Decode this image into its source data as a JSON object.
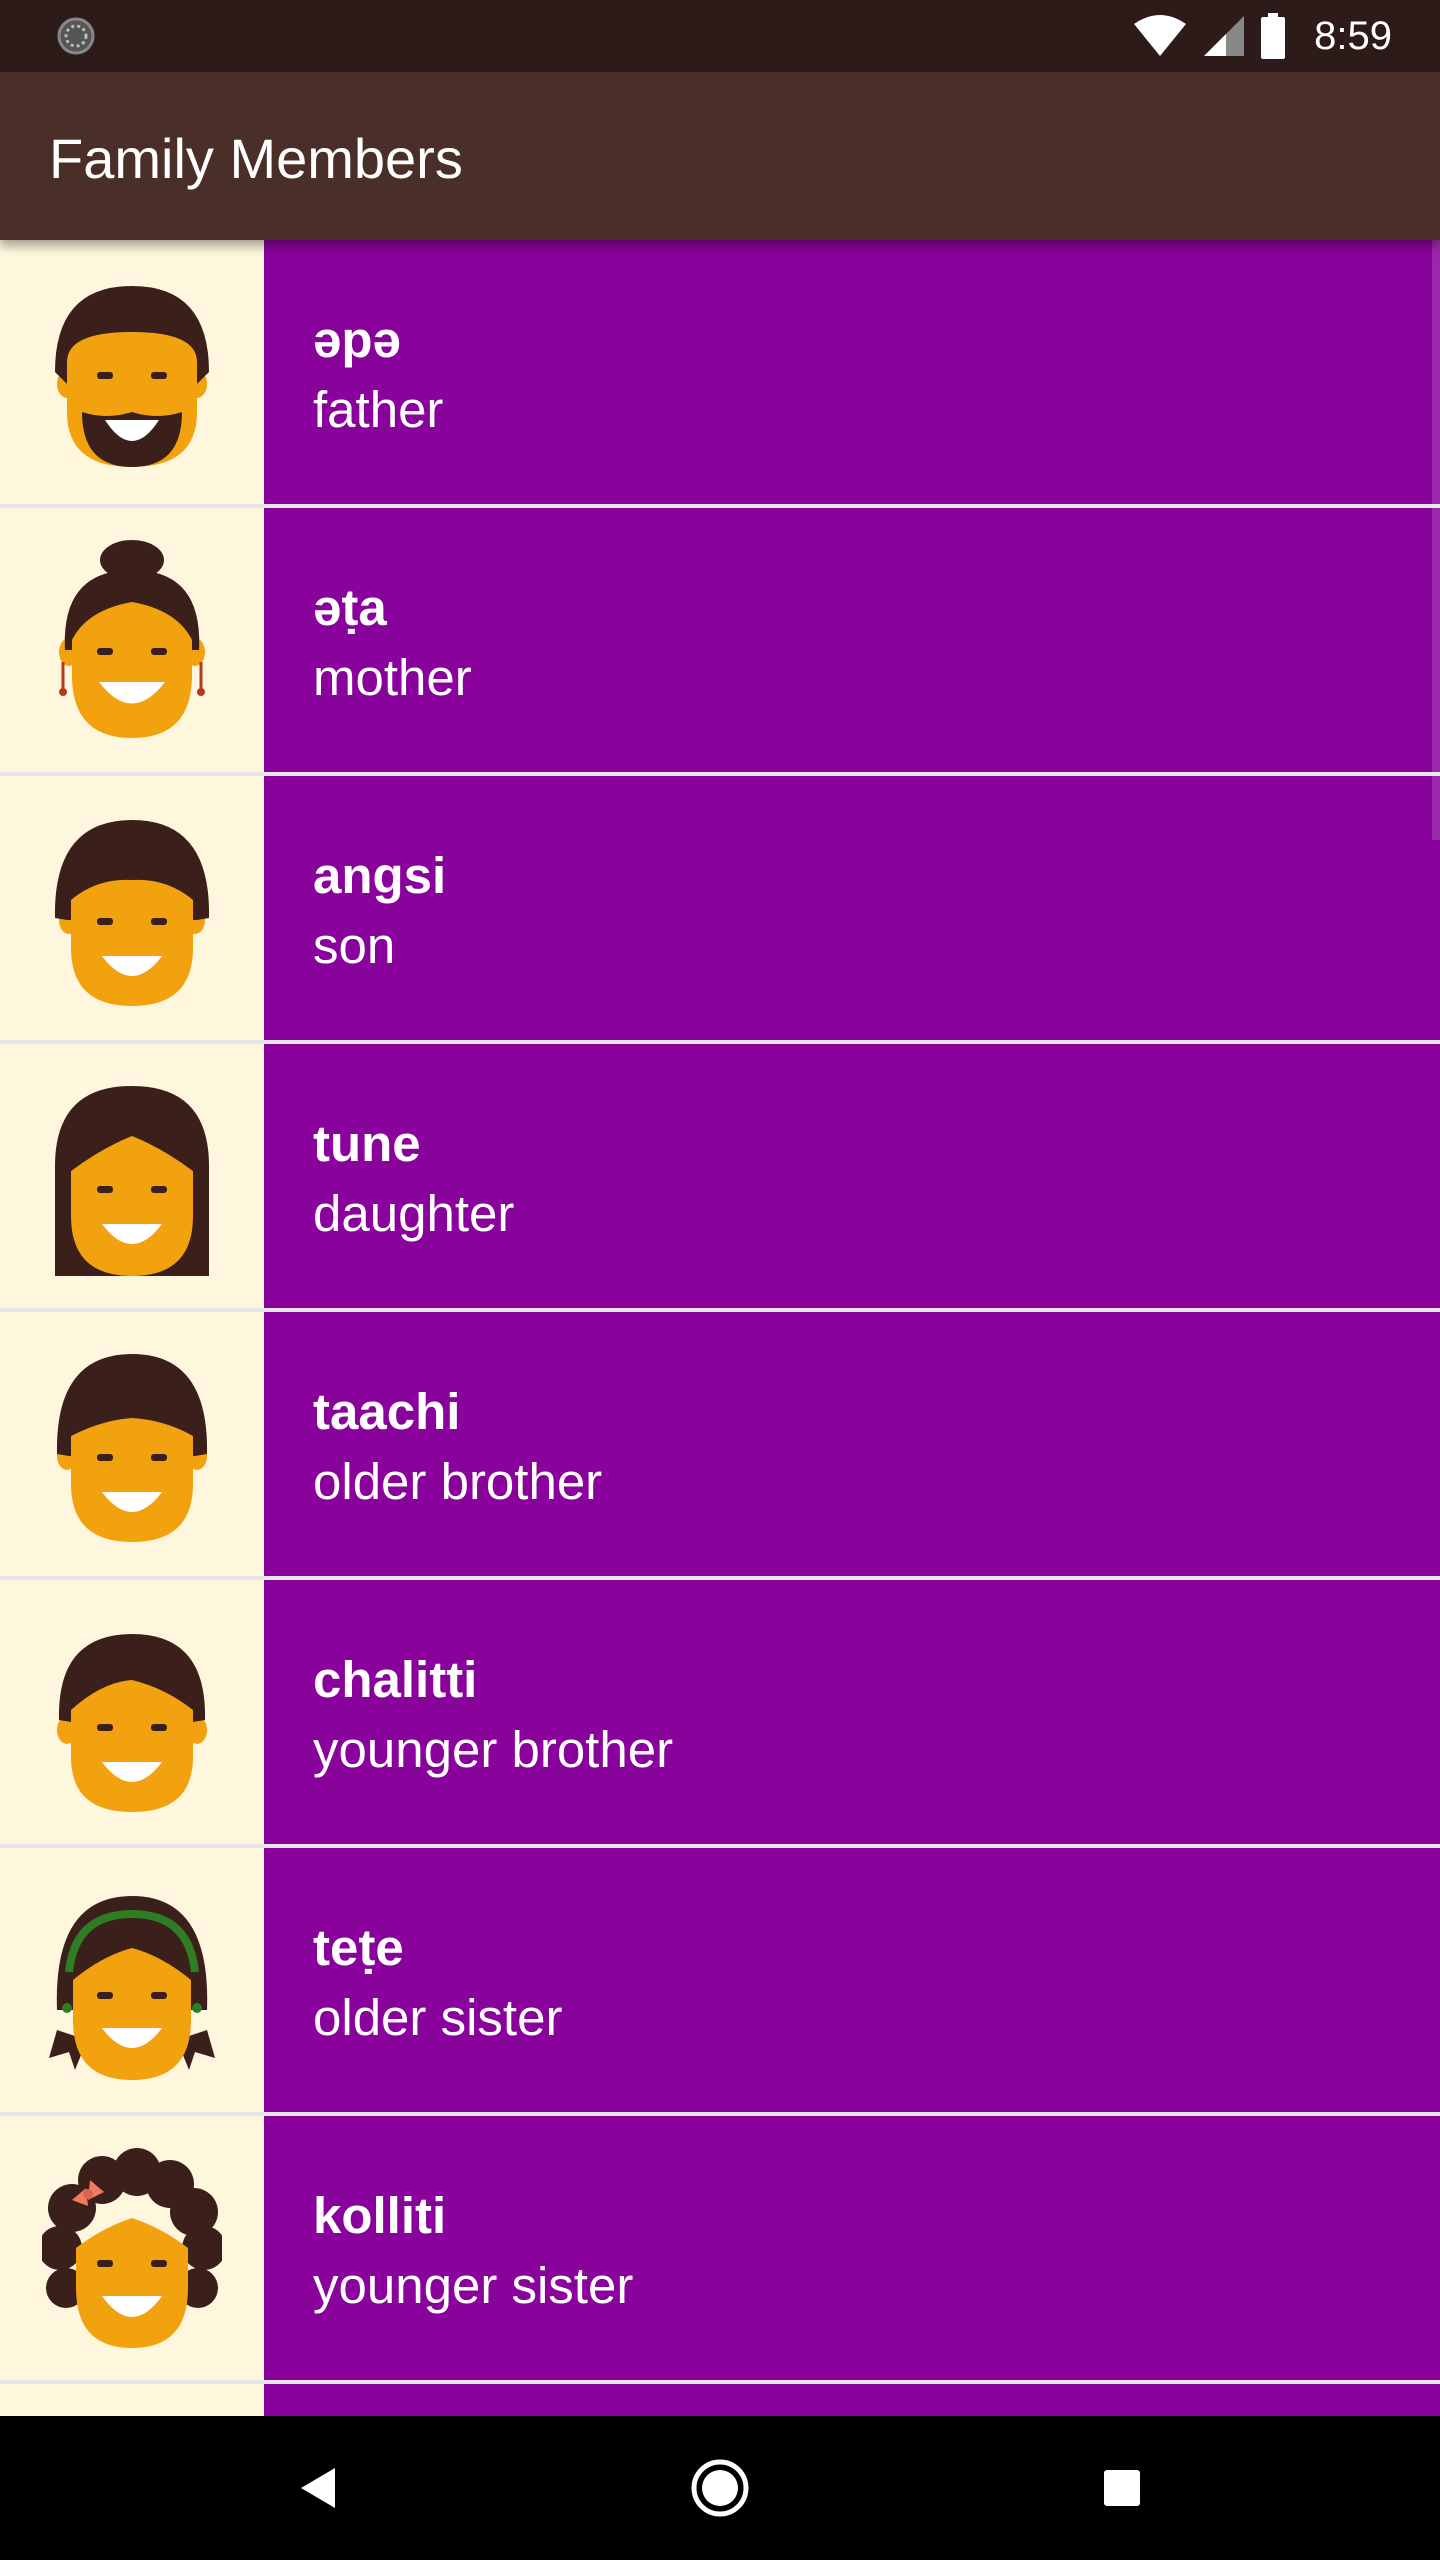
{
  "status_bar": {
    "time": "8:59",
    "icons": [
      "loading-icon",
      "wifi-icon",
      "cell-signal-icon",
      "battery-icon"
    ]
  },
  "app_bar": {
    "title": "Family Members"
  },
  "colors": {
    "status_bar": "#2d1b19",
    "app_bar": "#4a2f28",
    "item_background": "#8a029c",
    "image_background": "#fef7de",
    "skin": "#f2a10f",
    "hair": "#3b1f1a"
  },
  "items": [
    {
      "miwok": "əpə",
      "english": "father",
      "icon": "father-icon"
    },
    {
      "miwok": "əṭa",
      "english": "mother",
      "icon": "mother-icon"
    },
    {
      "miwok": "angsi",
      "english": "son",
      "icon": "son-icon"
    },
    {
      "miwok": "tune",
      "english": "daughter",
      "icon": "daughter-icon"
    },
    {
      "miwok": "taachi",
      "english": "older brother",
      "icon": "older-brother-icon"
    },
    {
      "miwok": "chalitti",
      "english": "younger brother",
      "icon": "younger-brother-icon"
    },
    {
      "miwok": "teṭe",
      "english": "older sister",
      "icon": "older-sister-icon"
    },
    {
      "miwok": "kolliti",
      "english": "younger sister",
      "icon": "younger-sister-icon"
    }
  ],
  "nav_bar": {
    "icons": [
      "back-icon",
      "home-icon",
      "recents-icon"
    ]
  }
}
